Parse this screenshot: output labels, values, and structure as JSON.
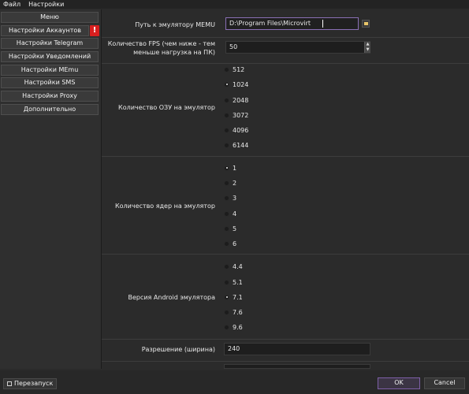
{
  "menubar": {
    "file": "Файл",
    "settings": "Настройки"
  },
  "sidebar": {
    "items": [
      {
        "label": "Меню"
      },
      {
        "label": "Настройки Аккаунтов"
      },
      {
        "label": "Настройки Telegram"
      },
      {
        "label": "Настройки Уведомлений"
      },
      {
        "label": "Настройки MEmu"
      },
      {
        "label": "Настройки SMS"
      },
      {
        "label": "Настройки Proxy"
      },
      {
        "label": "Дополнительно"
      }
    ],
    "warning_badge": "!"
  },
  "settings": {
    "memu_path_label": "Путь к эмулятору MEMU",
    "memu_path_value": "D:\\Program Files\\Microvirt",
    "fps_label_line1": "Количество FPS (чем ниже - тем",
    "fps_label_line2": "меньше нагрузка на ПК)",
    "fps_value": "50",
    "ram_label": "Количество ОЗУ на эмулятор",
    "ram_options": [
      "512",
      "1024",
      "2048",
      "3072",
      "4096",
      "6144"
    ],
    "ram_selected": "1024",
    "cores_label": "Количество ядер на эмулятор",
    "cores_options": [
      "1",
      "2",
      "3",
      "4",
      "5",
      "6"
    ],
    "cores_selected": "1",
    "android_label": "Версия Android эмулятора",
    "android_options": [
      "4.4",
      "5.1",
      "7.1",
      "7.6",
      "9.6"
    ],
    "android_selected": "7.1",
    "resolution_label": "Разрешение (ширина)",
    "resolution_value": "240"
  },
  "bottombar": {
    "restart_label": "Перезапуск",
    "ok_label": "OK",
    "cancel_label": "Cancel"
  }
}
